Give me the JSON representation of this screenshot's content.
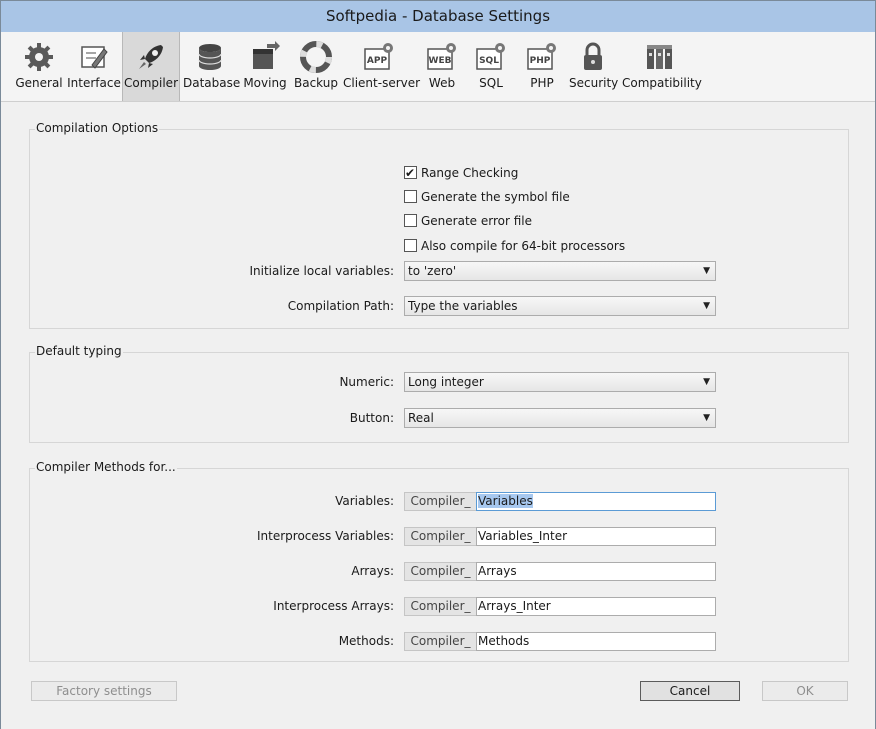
{
  "window": {
    "title": "Softpedia - Database Settings"
  },
  "toolbar": {
    "items": [
      {
        "label": "General",
        "icon": "gear-icon"
      },
      {
        "label": "Interface",
        "icon": "pencil-icon"
      },
      {
        "label": "Compiler",
        "icon": "rocket-icon",
        "active": true
      },
      {
        "label": "Database",
        "icon": "database-icon"
      },
      {
        "label": "Moving",
        "icon": "moving-box-icon"
      },
      {
        "label": "Backup",
        "icon": "lifebuoy-icon"
      },
      {
        "label": "Client-server",
        "icon": "app-gear-icon"
      },
      {
        "label": "Web",
        "icon": "web-gear-icon"
      },
      {
        "label": "SQL",
        "icon": "sql-gear-icon"
      },
      {
        "label": "PHP",
        "icon": "php-gear-icon"
      },
      {
        "label": "Security",
        "icon": "padlock-icon"
      },
      {
        "label": "Compatibility",
        "icon": "compatibility-icon"
      }
    ]
  },
  "compilation_options": {
    "title": "Compilation Options",
    "checkboxes": [
      {
        "label": "Range Checking",
        "checked": true
      },
      {
        "label": "Generate the symbol file",
        "checked": false
      },
      {
        "label": "Generate error file",
        "checked": false
      },
      {
        "label": "Also compile for 64-bit processors",
        "checked": false
      }
    ],
    "init_local_vars_label": "Initialize local variables:",
    "init_local_vars_value": "to 'zero'",
    "compilation_path_label": "Compilation Path:",
    "compilation_path_value": "Type the variables"
  },
  "default_typing": {
    "title": "Default typing",
    "numeric_label": "Numeric:",
    "numeric_value": "Long integer",
    "button_label": "Button:",
    "button_value": "Real"
  },
  "compiler_methods": {
    "title": "Compiler Methods for...",
    "prefix": "Compiler_",
    "rows": [
      {
        "label": "Variables:",
        "value": "Variables"
      },
      {
        "label": "Interprocess Variables:",
        "value": "Variables_Inter"
      },
      {
        "label": "Arrays:",
        "value": "Arrays"
      },
      {
        "label": "Interprocess Arrays:",
        "value": "Arrays_Inter"
      },
      {
        "label": "Methods:",
        "value": "Methods"
      }
    ]
  },
  "buttons": {
    "factory": "Factory settings",
    "cancel": "Cancel",
    "ok": "OK"
  },
  "colors": {
    "titlebar": "#a9c5e6",
    "window_bg": "#f0f0f0",
    "selection": "#a7c8ef",
    "focus_border": "#5b9bd5"
  }
}
